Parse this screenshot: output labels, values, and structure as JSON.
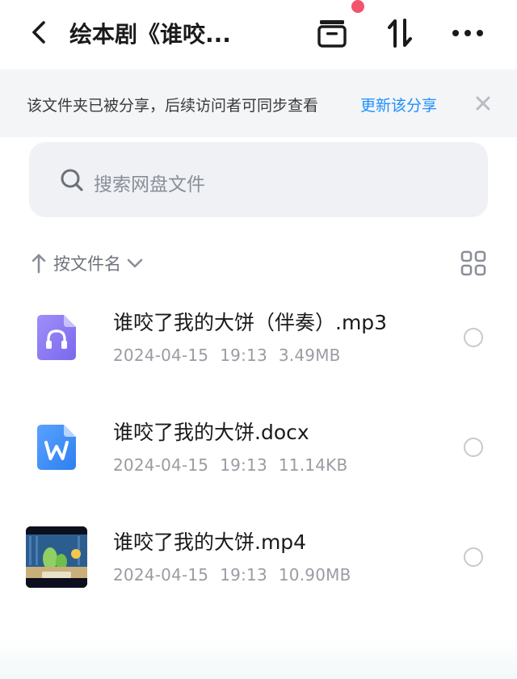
{
  "header": {
    "title": "绘本剧《谁咬...",
    "icons": [
      "back-arrow-icon",
      "archive-box-icon",
      "sort-arrows-icon",
      "more-dots-icon"
    ],
    "notification_color": "#f2536e"
  },
  "banner": {
    "text": "该文件夹已被分享，后续访问者可同步查看",
    "link": "更新该分享",
    "link_color": "#1e90ff"
  },
  "search": {
    "placeholder": "搜索网盘文件"
  },
  "sortbar": {
    "label": "按文件名"
  },
  "files": [
    {
      "name": "谁咬了我的大饼（伴奏）.mp3",
      "date": "2024-04-15",
      "time": "19:13",
      "size": "3.49MB",
      "icon": "audio-file-icon",
      "color": "#8b7cf6"
    },
    {
      "name": "谁咬了我的大饼.docx",
      "date": "2024-04-15",
      "time": "19:13",
      "size": "11.14KB",
      "icon": "word-file-icon",
      "color": "#3f8cf5"
    },
    {
      "name": "谁咬了我的大饼.mp4",
      "date": "2024-04-15",
      "time": "19:13",
      "size": "10.90MB",
      "icon": "video-thumbnail",
      "color": "#0b0f1e"
    }
  ]
}
